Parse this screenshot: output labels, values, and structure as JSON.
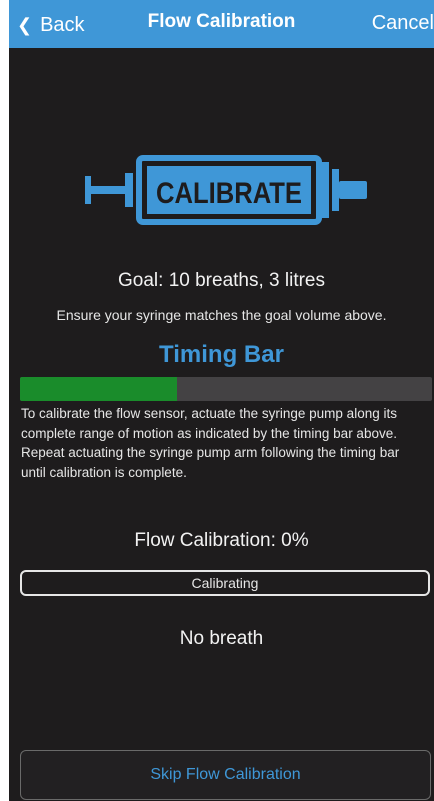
{
  "nav": {
    "back_label": "Back",
    "title": "Flow Calibration",
    "cancel_label": "Cancel"
  },
  "logo": {
    "text": "CALIBRATE",
    "icon": "syringe-icon",
    "color": "#3f97d7"
  },
  "goal_text": "Goal: 10 breaths, 3 litres",
  "ensure_text": "Ensure your syringe matches the goal volume above.",
  "timing": {
    "title": "Timing Bar",
    "progress": 0.38
  },
  "instructions": "To calibrate the flow sensor, actuate the syringe pump along its complete range of motion as indicated by the timing bar above. Repeat actuating the syringe pump arm following the timing bar until calibration is complete.",
  "flow_calibration_text": "Flow Calibration: 0%",
  "status_button_label": "Calibrating",
  "breath_text": "No breath",
  "skip_button_label": "Skip Flow Calibration",
  "colors": {
    "accent": "#3f97d7",
    "background": "#1e1c1d",
    "progress_fill": "#1a8c2b"
  }
}
